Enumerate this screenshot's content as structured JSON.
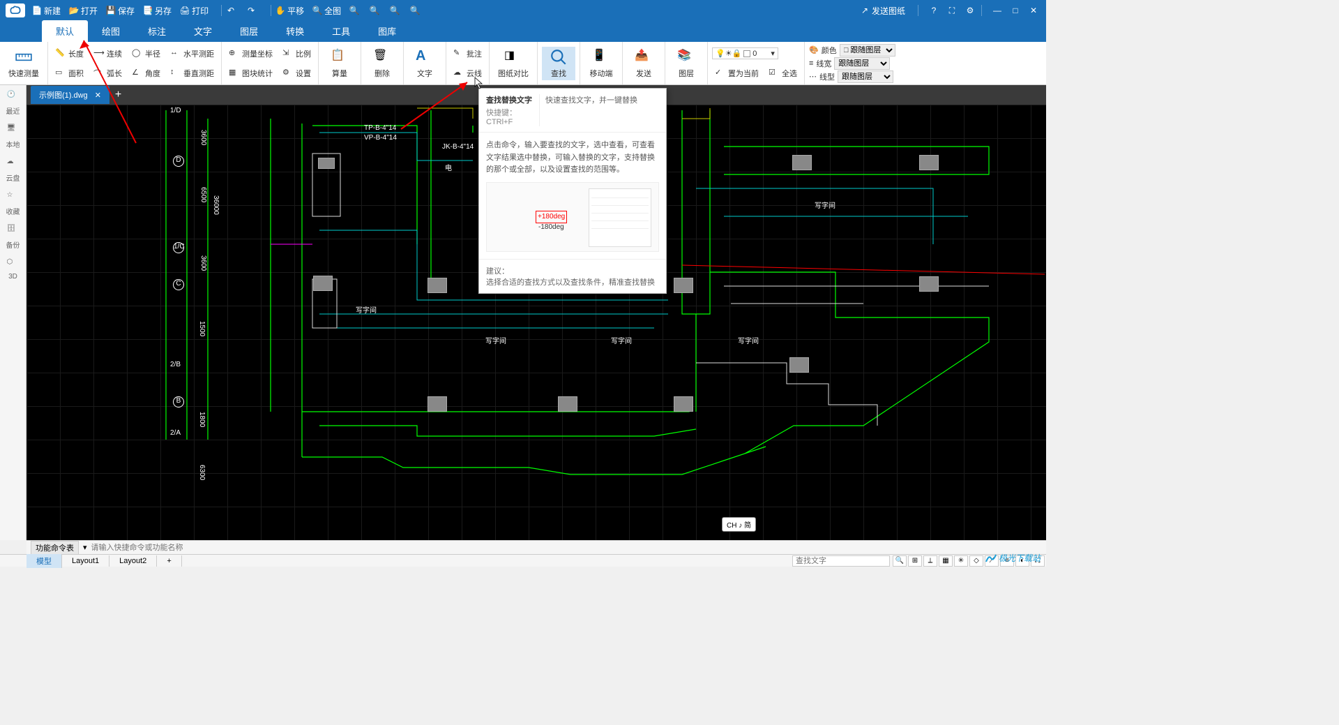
{
  "titlebar": {
    "new": "新建",
    "open": "打开",
    "save": "保存",
    "saveas": "另存",
    "print": "打印",
    "pan": "平移",
    "fullview": "全图",
    "send_drawing": "发送图纸"
  },
  "menutabs": [
    "默认",
    "绘图",
    "标注",
    "文字",
    "图层",
    "转换",
    "工具",
    "图库"
  ],
  "ribbon": {
    "quick_measure": "快速测量",
    "length": "长度",
    "continuous": "连续",
    "radius": "半径",
    "hdist": "水平测距",
    "area": "面积",
    "arc": "弧长",
    "angle": "角度",
    "vdist": "垂直测距",
    "coord": "测量坐标",
    "scale": "比例",
    "block_stat": "图块统计",
    "settings": "设置",
    "calc": "算量",
    "delete": "删除",
    "text": "文字",
    "annotate": "批注",
    "cloud": "云线",
    "compare": "图纸对比",
    "find": "查找",
    "mobile": "移动端",
    "send": "发送",
    "layer": "图层",
    "set_current": "置为当前",
    "select_all": "全选",
    "color": "颜色",
    "lineweight": "线宽",
    "linetype": "线型",
    "bylayer": "跟随图层",
    "layer_num": "0"
  },
  "sidepanel": {
    "recent": "最近",
    "local": "本地",
    "cloud": "云盘",
    "favorite": "收藏",
    "backup": "备份",
    "three_d": "3D"
  },
  "filetab": {
    "name": "示例图(1).dwg"
  },
  "tooltip": {
    "title": "查找替换文字",
    "shortcut_label": "快捷键：",
    "shortcut": "CTRl+F",
    "brief": "快速查找文字，并一键替换",
    "detail": "点击命令，输入要查找的文字，选中查看，可查看文字结果选中替换，可输入替换的文字，支持替换的那个或全部，以及设置查找的范围等。",
    "deg1": "+180deg",
    "deg2": "-180deg",
    "suggest_label": "建议：",
    "suggest": "选择合适的查找方式以及查找条件，精准查找替换"
  },
  "canvas_labels": {
    "tp": "TP-B-4\"14",
    "vp": "VP-B-4\"14",
    "jk": "JK-B-4\"14",
    "dian": "电",
    "writing_room": "写字间",
    "grid_d": "D",
    "grid_c": "C",
    "grid_b": "B",
    "grid_a": "A",
    "grid_1d": "1/D",
    "grid_1c": "1/C",
    "grid_2a": "2/A",
    "grid_2b": "2/B",
    "dim_3600": "3600",
    "dim_6500": "6500",
    "dim_3600b": "3600",
    "dim_36000": "36000",
    "dim_1500": "1500",
    "dim_1800": "1800",
    "dim_6300": "6300"
  },
  "cmdbar": {
    "label": "功能命令表",
    "placeholder": "请输入快捷命令或功能名称"
  },
  "statusbar": {
    "layouts": [
      "模型",
      "Layout1",
      "Layout2"
    ],
    "search_placeholder": "查找文字"
  },
  "ime": "CH ♪ 简",
  "watermark": "极光下载站"
}
